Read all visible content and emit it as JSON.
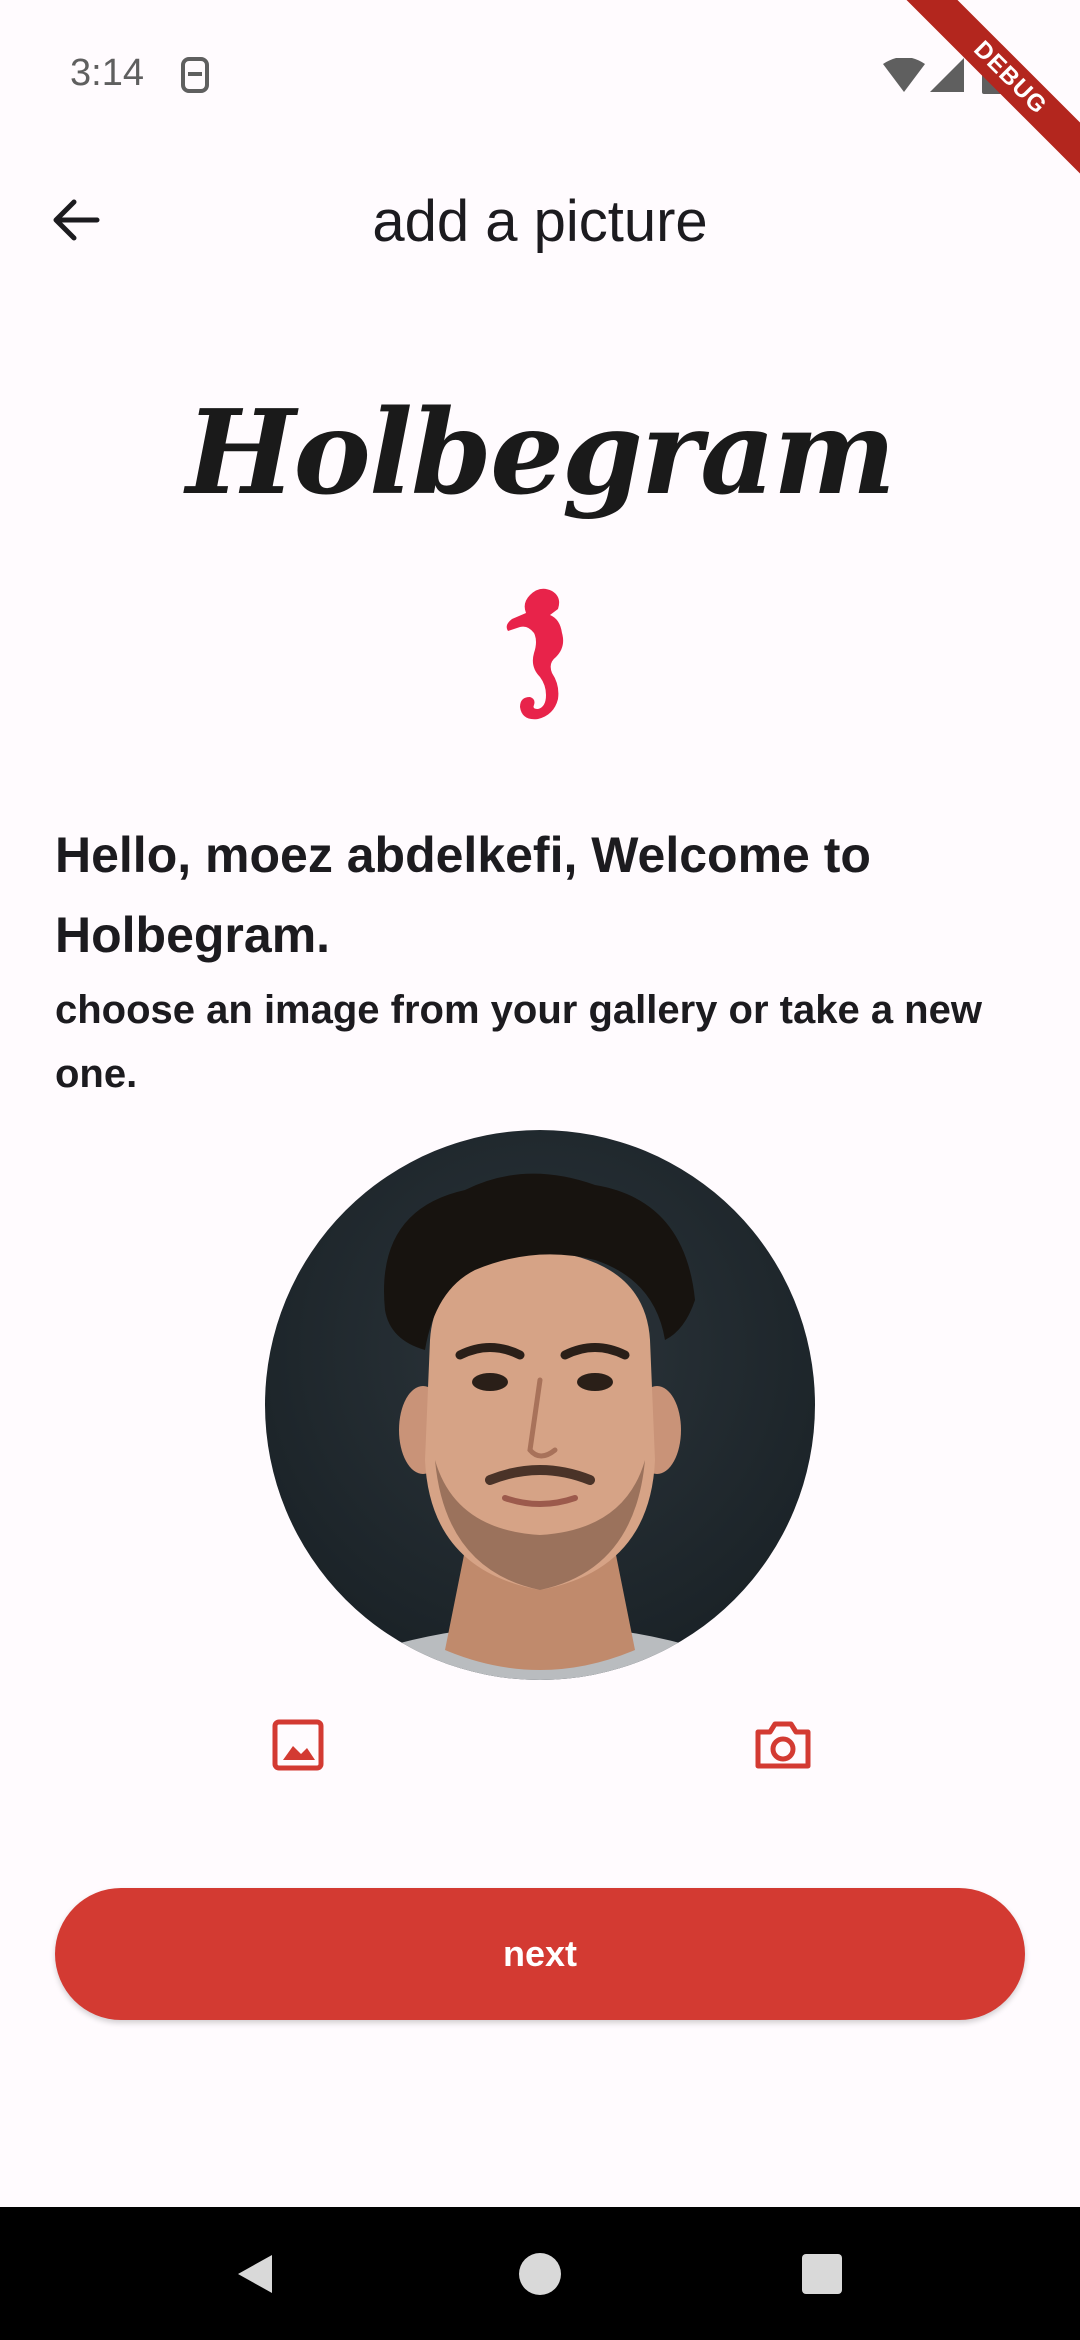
{
  "status_bar": {
    "time": "3:14",
    "icons": [
      "sim-icon",
      "wifi-icon",
      "signal-icon",
      "battery-icon"
    ],
    "debug_label": "DEBUG"
  },
  "app_bar": {
    "back_icon": "arrow-left-icon",
    "title": "add a picture"
  },
  "brand": {
    "name": "Holbegram",
    "logo_icon": "seahorse-icon",
    "logo_color": "#e8234a"
  },
  "greeting": "Hello, moez abdelkefi, Welcome to Holbegram.",
  "instruction": "choose an image from your gallery or take a new one.",
  "actions": {
    "gallery_icon": "gallery-icon",
    "camera_icon": "camera-icon",
    "icon_color": "#d33a32"
  },
  "next_button": {
    "label": "next",
    "color": "#d33a32"
  },
  "nav_bar": {
    "keys": [
      "back-triangle-icon",
      "home-circle-icon",
      "recents-square-icon"
    ]
  }
}
